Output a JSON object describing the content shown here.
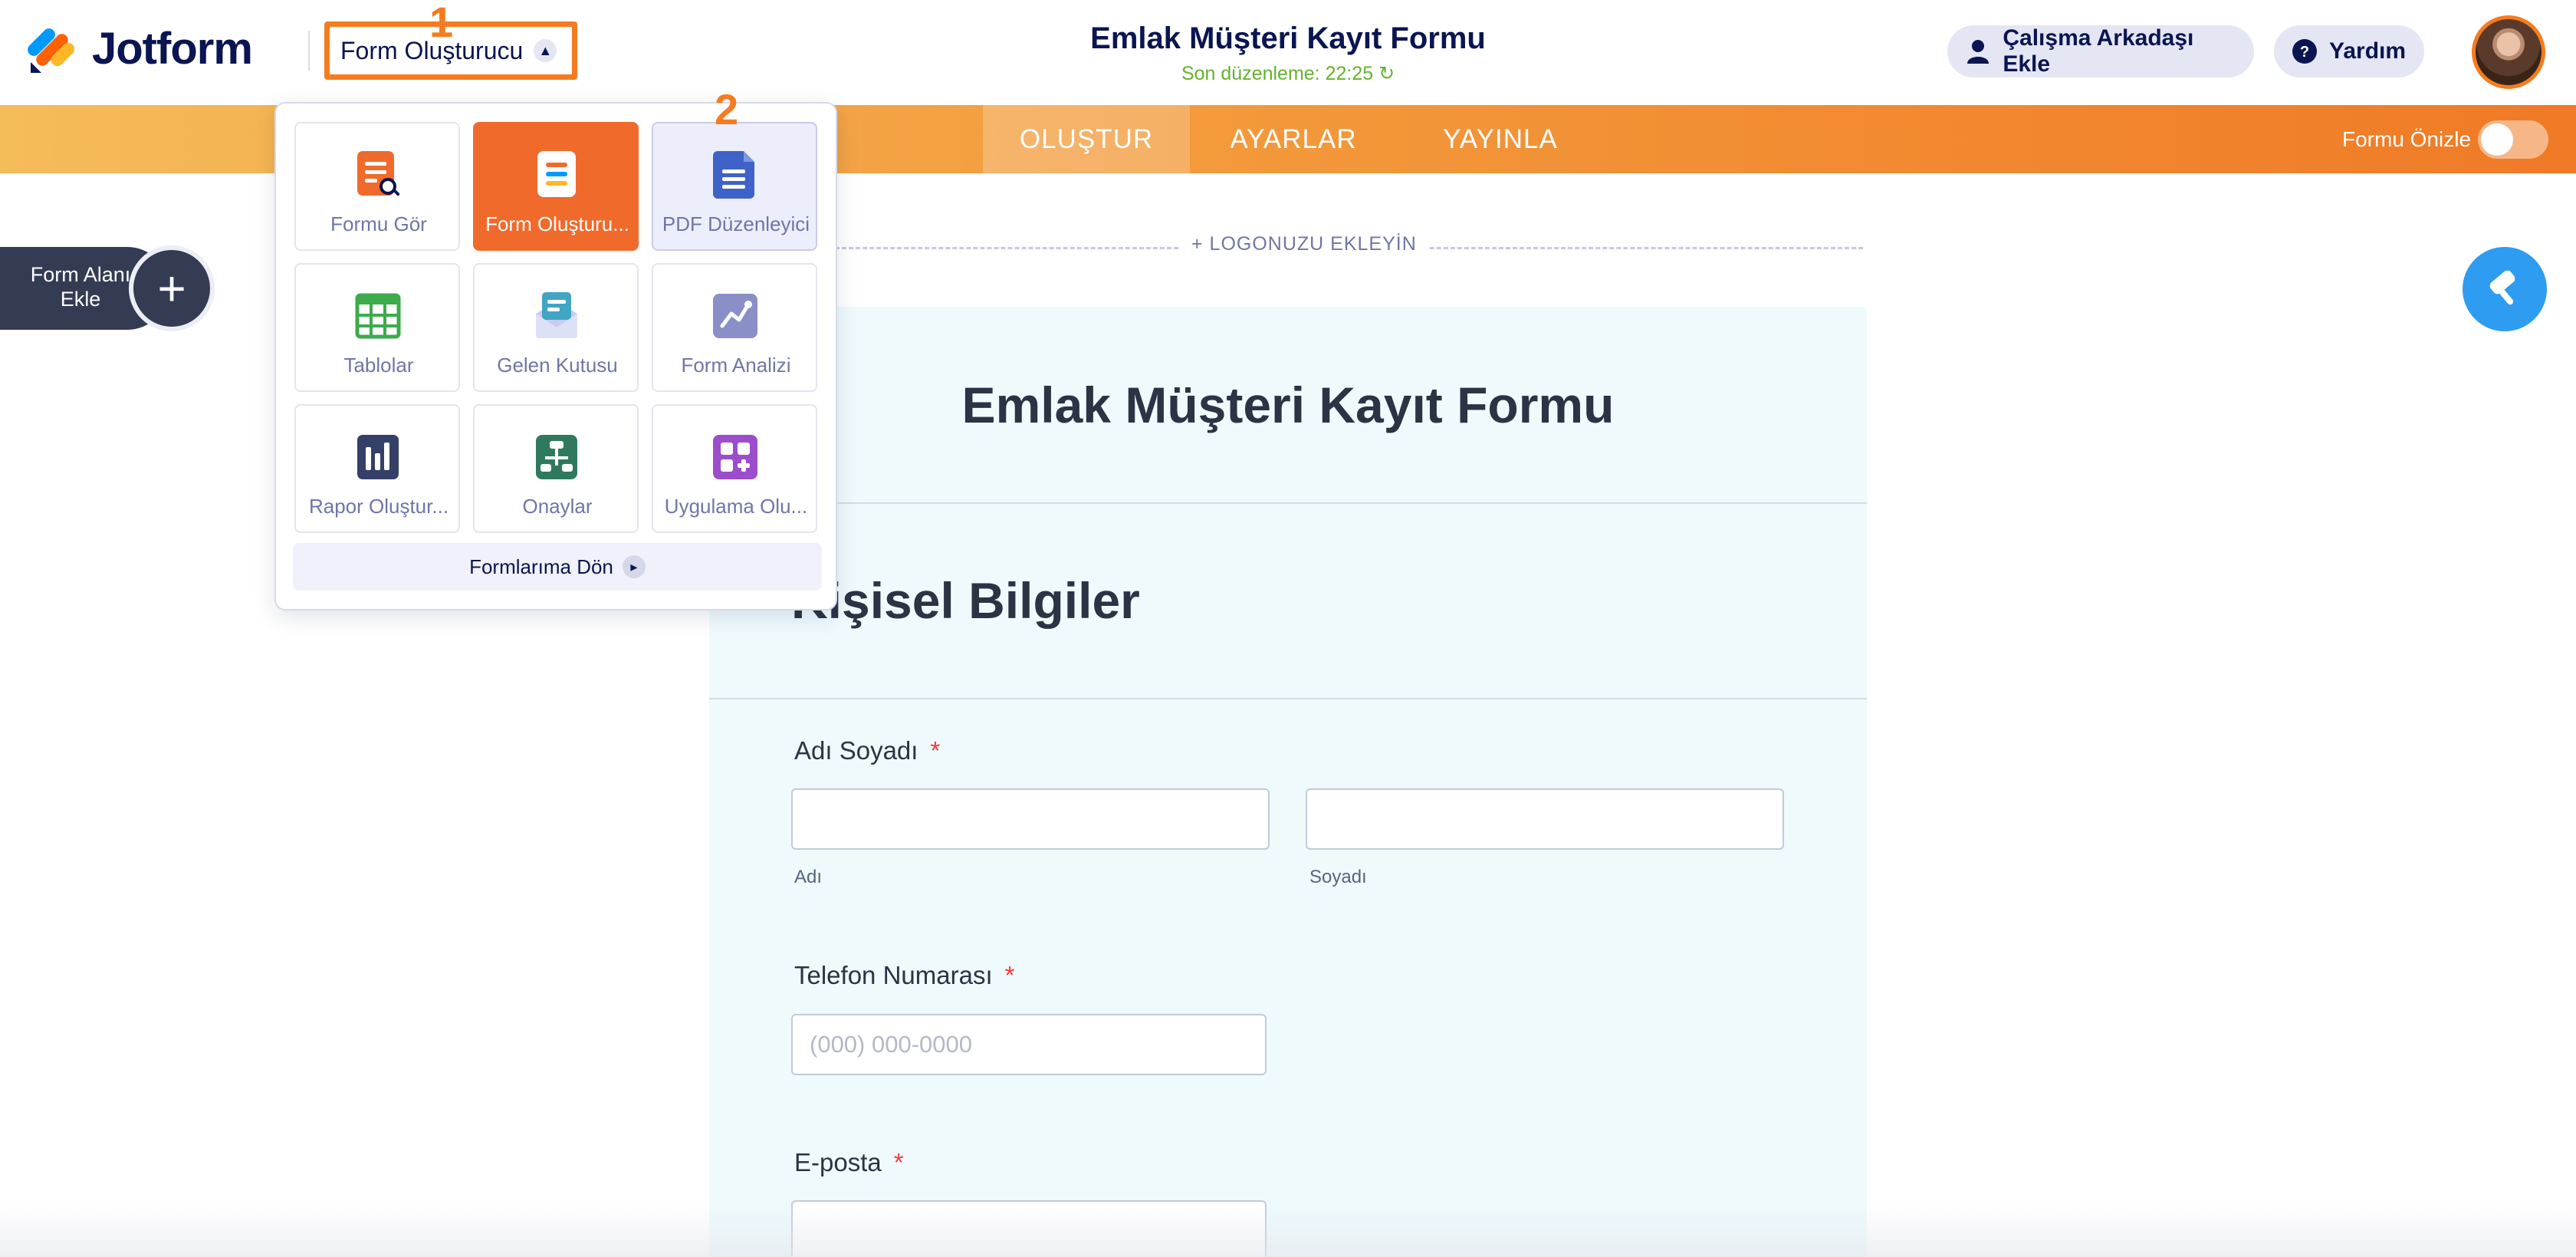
{
  "header": {
    "brand": "Jotform",
    "builder_dropdown": "Form Oluşturucu",
    "form_title": "Emlak Müşteri Kayıt Formu",
    "last_edit": "Son düzenleme: 22:25 ↻",
    "invite_label": "Çalışma Arkadaşı Ekle",
    "help_label": "Yardım",
    "annotation_1": "1",
    "annotation_2": "2"
  },
  "nav": {
    "tabs": [
      {
        "label": "OLUŞTUR",
        "active": true
      },
      {
        "label": "AYARLAR",
        "active": false
      },
      {
        "label": "YAYINLA",
        "active": false
      }
    ],
    "preview_label": "Formu Önizle"
  },
  "menu": {
    "tiles": [
      {
        "label": "Formu Gör",
        "icon": "form-view-icon"
      },
      {
        "label": "Form Oluşturu...",
        "icon": "form-builder-icon"
      },
      {
        "label": "PDF Düzenleyici",
        "icon": "pdf-editor-icon"
      },
      {
        "label": "Tablolar",
        "icon": "tables-icon"
      },
      {
        "label": "Gelen Kutusu",
        "icon": "inbox-icon"
      },
      {
        "label": "Form Analizi",
        "icon": "form-analytics-icon"
      },
      {
        "label": "Rapor Oluştur...",
        "icon": "report-builder-icon"
      },
      {
        "label": "Onaylar",
        "icon": "approvals-icon"
      },
      {
        "label": "Uygulama Olu...",
        "icon": "app-builder-icon"
      }
    ],
    "footer_label": "Formlarıma Dön"
  },
  "sidebar": {
    "add_field_label": "Form Alanı Ekle"
  },
  "canvas": {
    "logo_placeholder": "+ LOGONUZU EKLEYİN",
    "heading": "Emlak Müşteri Kayıt Formu",
    "section_title": "Kişisel Bilgiler",
    "fields": {
      "name_label": "Adı Soyadı",
      "first_sub": "Adı",
      "last_sub": "Soyadı",
      "phone_label": "Telefon Numarası",
      "phone_placeholder": "(000) 000-0000",
      "email_label": "E-posta",
      "required_mark": "*"
    }
  },
  "colors": {
    "accent_orange": "#f47c1f",
    "brand_navy": "#0a1551",
    "paint_blue": "#2e9cf0",
    "form_bg": "#eefafc"
  }
}
